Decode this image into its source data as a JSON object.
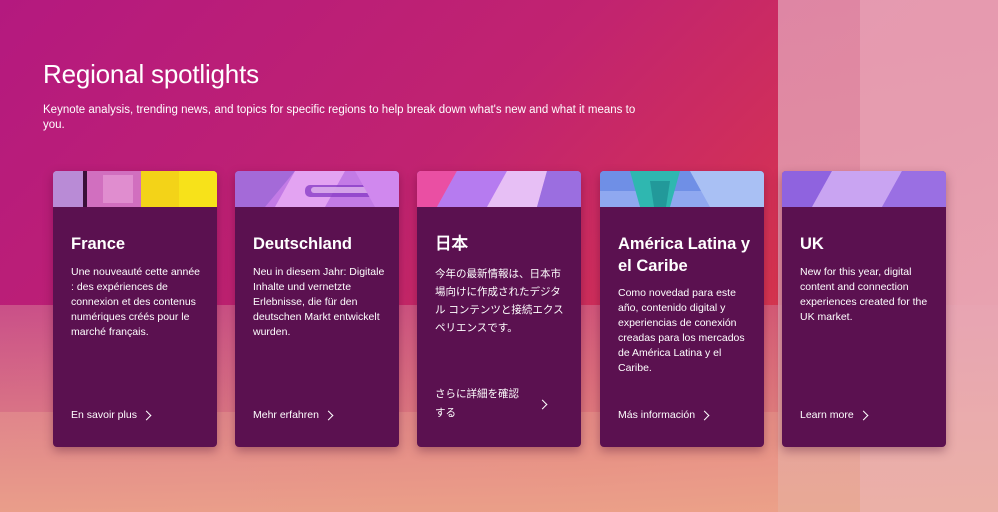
{
  "header": {
    "title": "Regional spotlights",
    "subtitle": "Keynote analysis, trending news, and topics for specific regions to help break down what's new and what it means to you."
  },
  "cards": [
    {
      "heading": "France",
      "body": "Une nouveauté cette année : des expériences de connexion et des contenus numériques créés pour le marché français.",
      "link": "En savoir plus"
    },
    {
      "heading": "Deutschland",
      "body": "Neu in diesem Jahr: Digitale Inhalte und vernetzte Erlebnisse, die für den deutschen Markt entwickelt wurden.",
      "link": "Mehr erfahren"
    },
    {
      "heading": "日本",
      "body": "今年の最新情報は、日本市場向けに作成されたデジタル コンテンツと接続エクスペリエンスです。",
      "link": "さらに詳細を確認する"
    },
    {
      "heading": "América Latina y el Caribe",
      "body": "Como novedad para este año, contenido digital y experiencias de conexión creadas para los mercados de América Latina y el Caribe.",
      "link": "Más información"
    },
    {
      "heading": "UK",
      "body": "New for this year, digital content and connection experiences created for the UK market.",
      "link": "Learn more"
    }
  ],
  "colors": {
    "card_background": "#5b1150",
    "page_gradient_start": "#b4197f",
    "page_gradient_end": "#e66a6a"
  }
}
